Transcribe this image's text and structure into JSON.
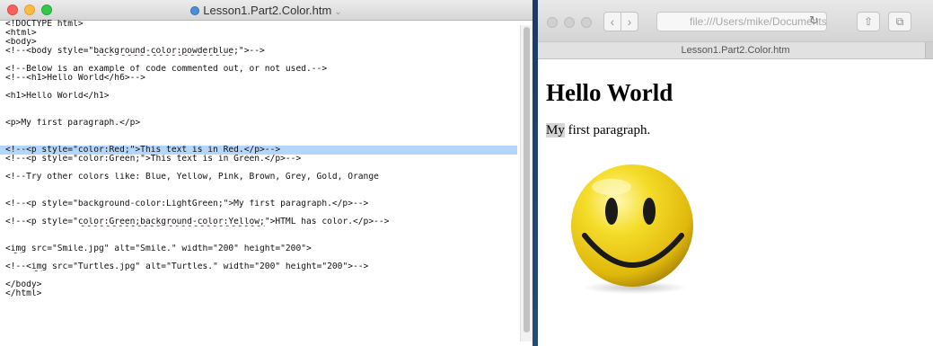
{
  "editor": {
    "title": "Lesson1.Part2.Color.htm",
    "title_chevron": "⌄",
    "lines": [
      {
        "text": "<!DOCTYPE html>"
      },
      {
        "text": "<html>"
      },
      {
        "text": "<body>"
      },
      {
        "pre": "<!--<body style=\"",
        "squig": "background-color:powderblue",
        "post": ";\">-->"
      },
      {
        "text": ""
      },
      {
        "text": "<!--Below is an example of code commented out, or not used.-->"
      },
      {
        "text": "<!--<h1>Hello World</h6>-->"
      },
      {
        "text": ""
      },
      {
        "text": "<h1>Hello World</h1>"
      },
      {
        "text": ""
      },
      {
        "text": ""
      },
      {
        "text": "<p>My first paragraph.</p>"
      },
      {
        "text": ""
      },
      {
        "text": ""
      },
      {
        "text": "<!--<p style=\"color:Red;\">This text is in Red.</p>-->",
        "highlight": true
      },
      {
        "text": "<!--<p style=\"color:Green;\">This text is in Green.</p>-->"
      },
      {
        "text": ""
      },
      {
        "text": "<!--Try other colors like: Blue, Yellow, Pink, Brown, Grey, Gold, Orange"
      },
      {
        "text": ""
      },
      {
        "text": ""
      },
      {
        "text": "<!--<p style=\"background-color:LightGreen;\">My first paragraph.</p>-->"
      },
      {
        "text": ""
      },
      {
        "pre": "<!--<p style=\"",
        "squig": "color:Green;background-color:Yellow;",
        "post": "\">HTML has color.</p>-->"
      },
      {
        "text": ""
      },
      {
        "text": ""
      },
      {
        "pre": "<",
        "squig": "img",
        "post": " src=\"Smile.jpg\" alt=\"Smile.\" width=\"200\" height=\"200\">"
      },
      {
        "text": ""
      },
      {
        "pre": "<!--<",
        "squig": "img",
        "post": " src=\"Turtles.jpg\" alt=\"Turtles.\" width=\"200\" height=\"200\">-->"
      },
      {
        "text": ""
      },
      {
        "text": "</body>"
      },
      {
        "text": "</html>"
      }
    ]
  },
  "browser": {
    "back_icon": "chevron-left-icon",
    "back_glyph": "‹",
    "forward_glyph": "›",
    "address": "file:///Users/mike/Documents",
    "reload_glyph": "↻",
    "share_glyph": "⇧",
    "tabs_glyph": "⧉",
    "tab_title": "Lesson1.Part2.Color.htm",
    "page": {
      "heading": "Hello World",
      "para_selected": "My",
      "para_rest": " first paragraph.",
      "image_alt": "Smile."
    }
  },
  "colors": {
    "selection_highlight": "#b4d6fb",
    "smiley_yellow": "#f2d21b",
    "desktop": "#1e3a5c"
  }
}
